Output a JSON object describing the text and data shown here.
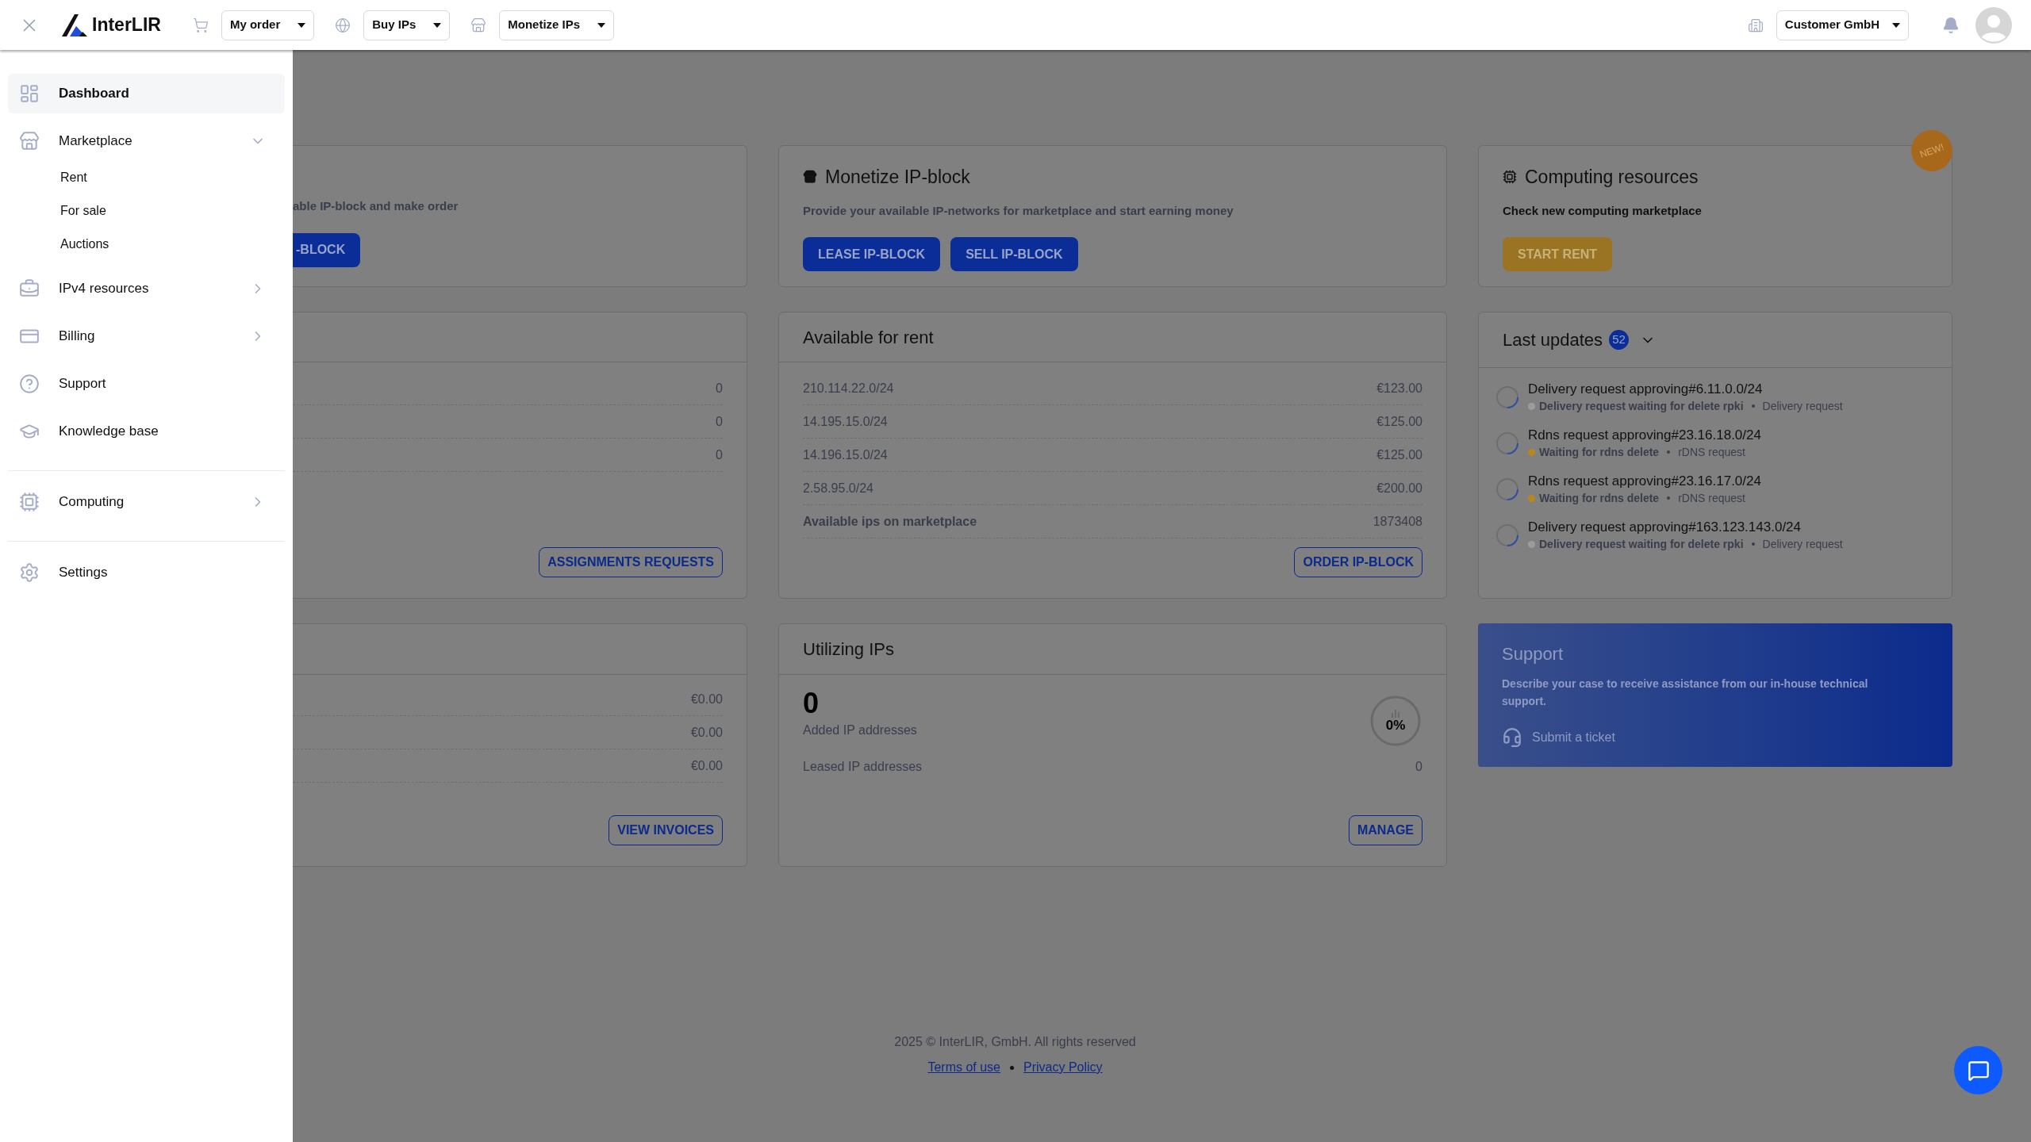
{
  "topbar": {
    "logo": "InterLIR",
    "menus": [
      {
        "label": "My order",
        "kind": "cart"
      },
      {
        "label": "Buy IPs",
        "kind": "globe"
      },
      {
        "label": "Monetize IPs",
        "kind": "store"
      }
    ],
    "account": "Customer GmbH"
  },
  "sidebar": {
    "groups": [
      [
        {
          "label": "Dashboard",
          "kind": "dashboard",
          "selected": true
        },
        {
          "label": "Marketplace",
          "kind": "store",
          "selected": false,
          "expanded": true,
          "children": [
            {
              "label": "Rent",
              "selected": false
            },
            {
              "label": "For sale",
              "selected": false
            },
            {
              "label": "Auctions",
              "selected": false
            }
          ]
        },
        {
          "label": "IPv4 resources",
          "kind": "briefcase",
          "selected": false,
          "expanded": false
        },
        {
          "label": "Billing",
          "kind": "card",
          "selected": false,
          "expanded": false
        },
        {
          "label": "Support",
          "kind": "help",
          "selected": false
        },
        {
          "label": "Knowledge base",
          "kind": "cap",
          "selected": false
        }
      ],
      [
        {
          "label": "Computing",
          "kind": "cpu",
          "selected": false,
          "expanded": false
        }
      ],
      [
        {
          "label": "Settings",
          "kind": "gear",
          "selected": false
        }
      ]
    ]
  },
  "order_card": {
    "description": "able IP-block and make order",
    "button": "-BLOCK"
  },
  "requests_card": {
    "values": [
      "0",
      "0",
      "0"
    ],
    "button": "ASSIGNMENTS REQUESTS"
  },
  "invoices_card": {
    "values": [
      "€0.00",
      "€0.00",
      "€0.00"
    ],
    "button": "VIEW INVOICES"
  },
  "monetize_card": {
    "title": "Monetize IP-block",
    "description": "Provide your available IP-networks for marketplace and start earning money",
    "buttons": [
      "LEASE IP-BLOCK",
      "SELL IP-BLOCK"
    ]
  },
  "available_for_rent": {
    "title": "Available for rent",
    "rows": [
      {
        "network": "210.114.22.0/24",
        "price": "€123.00"
      },
      {
        "network": "14.195.15.0/24",
        "price": "€125.00"
      },
      {
        "network": "14.196.15.0/24",
        "price": "€125.00"
      },
      {
        "network": "2.58.95.0/24",
        "price": "€200.00"
      }
    ],
    "total": {
      "label": "Available ips on marketplace",
      "value": "1873408"
    },
    "button": "ORDER IP-BLOCK"
  },
  "utilizing": {
    "title": "Utilizing IPs",
    "count": "0",
    "count_label": "Added IP addresses",
    "percent": "0%",
    "leased_label": "Leased IP addresses",
    "leased_value": "0",
    "button": "MANAGE"
  },
  "computing_card": {
    "title": "Computing resources",
    "description": "Check new computing marketplace",
    "button": "START RENT",
    "badge": "NEW!"
  },
  "last_updates": {
    "title": "Last updates",
    "count": "52",
    "expanded": true,
    "items": [
      {
        "title": "Delivery request approving#6.11.0.0/24",
        "status": "Delivery request waiting for delete rpki",
        "color": "#9c9c9c",
        "category": "Delivery request"
      },
      {
        "title": "Rdns request approving#23.16.18.0/24",
        "status": "Waiting for rdns delete",
        "color": "#b8861b",
        "category": "rDNS request"
      },
      {
        "title": "Rdns request approving#23.16.17.0/24",
        "status": "Waiting for rdns delete",
        "color": "#b8861b",
        "category": "rDNS request"
      },
      {
        "title": "Delivery request approving#163.123.143.0/24",
        "status": "Delivery request waiting for delete rpki",
        "color": "#9c9c9c",
        "category": "Delivery request"
      }
    ]
  },
  "support": {
    "title": "Support",
    "description": "Describe your case to receive assistance from our in-house technical support.",
    "link": "Submit a ticket"
  },
  "footer": {
    "copyright": "2025 © InterLIR, GmbH. All rights reserved",
    "links": [
      "Terms of use",
      "Privacy Policy"
    ]
  }
}
